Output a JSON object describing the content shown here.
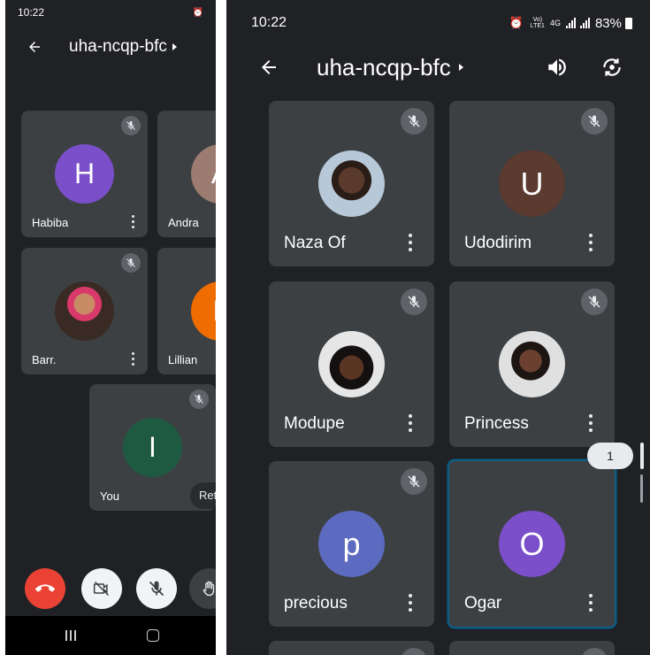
{
  "left_phone": {
    "status": {
      "time": "10:22"
    },
    "app_bar": {
      "meeting_code": "uha-ncqp-bfc"
    },
    "tiles": [
      {
        "name": "Habiba",
        "initial": "H",
        "color": "#7a4fc9"
      },
      {
        "name": "Andra",
        "initial": "A",
        "color": "#9c7b70"
      },
      {
        "name": "Barr.",
        "initial": "",
        "color": "#8a2c3c"
      },
      {
        "name": "Lillian",
        "initial": "L",
        "color": "#ef6c00"
      },
      {
        "name": "You",
        "initial": "I",
        "color": "#1e5a41"
      }
    ],
    "chip_label": "Ret",
    "controls": {
      "end_call_color": "#ea4335"
    }
  },
  "right_phone": {
    "status": {
      "time": "10:22",
      "network": "4G",
      "battery": "83%"
    },
    "app_bar": {
      "meeting_code": "uha-ncqp-bfc"
    },
    "tiles": [
      {
        "name": "Naza Of",
        "initial": "",
        "color": "#b7c9d8"
      },
      {
        "name": "Udodirim",
        "initial": "U",
        "color": "#5b3a2f"
      },
      {
        "name": "Modupe",
        "initial": "",
        "color": "#cfcfcf"
      },
      {
        "name": "Princess",
        "initial": "",
        "color": "#d8d8d8"
      },
      {
        "name": "precious",
        "initial": "p",
        "color": "#5c6bc0"
      },
      {
        "name": "Ogar",
        "initial": "O",
        "color": "#7a4fc9"
      }
    ],
    "page_indicator": "1"
  }
}
